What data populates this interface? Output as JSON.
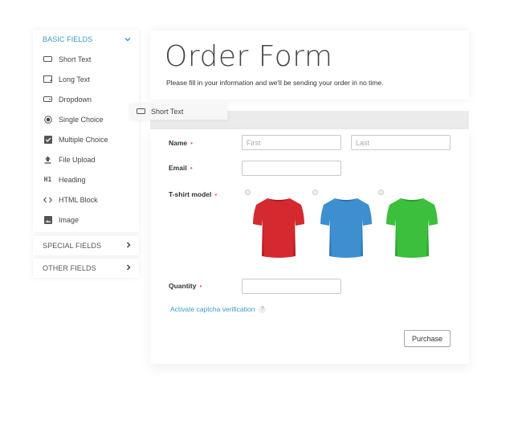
{
  "sidebar": {
    "basic": {
      "title": "BASIC FIELDS",
      "expanded": true,
      "items": [
        {
          "label": "Short Text",
          "icon": "short-text-icon"
        },
        {
          "label": "Long Text",
          "icon": "long-text-icon"
        },
        {
          "label": "Dropdown",
          "icon": "dropdown-icon"
        },
        {
          "label": "Single Choice",
          "icon": "radio-icon"
        },
        {
          "label": "Multiple Choice",
          "icon": "checkbox-icon"
        },
        {
          "label": "File Upload",
          "icon": "upload-icon"
        },
        {
          "label": "Heading",
          "icon": "heading-icon"
        },
        {
          "label": "HTML Block",
          "icon": "code-icon"
        },
        {
          "label": "Image",
          "icon": "image-icon"
        }
      ]
    },
    "special": {
      "title": "SPECIAL FIELDS"
    },
    "other": {
      "title": "OTHER FIELDS"
    }
  },
  "drag_ghost": {
    "label": "Short Text",
    "icon": "short-text-icon"
  },
  "form": {
    "title": "Order Form",
    "subtitle": "Please fill in your information and we'll be sending your order in no time.",
    "fields": {
      "name": {
        "label": "Name",
        "required_mark": "•",
        "first_placeholder": "First",
        "last_placeholder": "Last",
        "first_value": "",
        "last_value": ""
      },
      "email": {
        "label": "Email",
        "required_mark": "•",
        "value": ""
      },
      "tshirt": {
        "label": "T-shirt model",
        "required_mark": "•",
        "options": [
          {
            "name": "red-tshirt",
            "color": "#d42a2f",
            "shade": "#a71a20",
            "selected": false
          },
          {
            "name": "blue-tshirt",
            "color": "#3d8fd0",
            "shade": "#2a6fa8",
            "selected": false
          },
          {
            "name": "green-tshirt",
            "color": "#3bbf3d",
            "shade": "#279a2b",
            "selected": false
          }
        ]
      },
      "quantity": {
        "label": "Quantity",
        "required_mark": "•",
        "value": ""
      }
    },
    "captcha_link": "Activate captcha verification",
    "help_glyph": "?",
    "submit_label": "Purchase"
  },
  "colors": {
    "accent": "#3a9bd1",
    "required": "#e25555"
  }
}
